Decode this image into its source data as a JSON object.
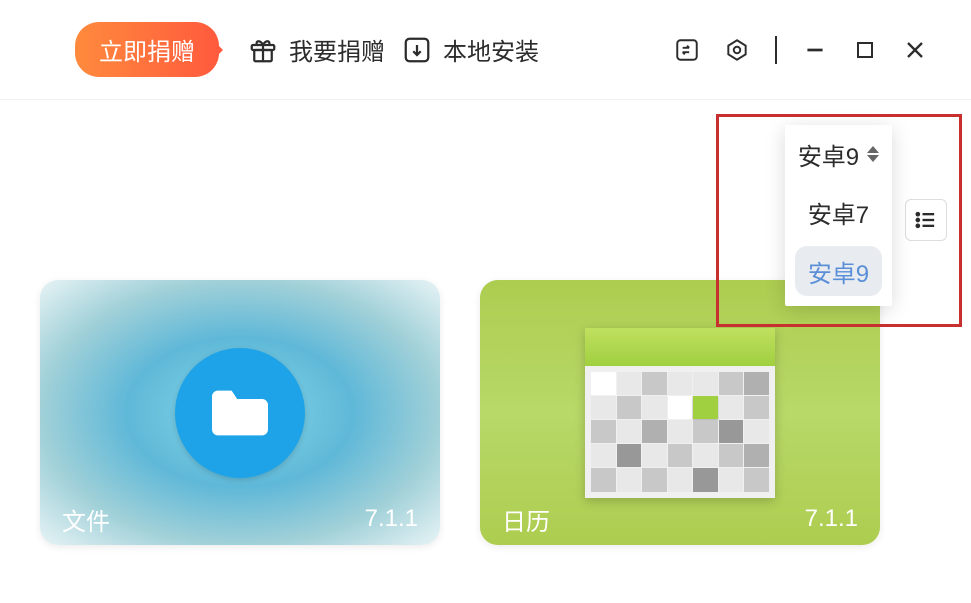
{
  "header": {
    "donate_btn_label": "立即捐赠",
    "want_donate_label": "我要捐赠",
    "local_install_label": "本地安装"
  },
  "dropdown": {
    "current": "安卓9",
    "options": [
      "安卓7",
      "安卓9"
    ],
    "selected_index": 1
  },
  "cards": {
    "files": {
      "name": "文件",
      "version": "7.1.1"
    },
    "calendar": {
      "name": "日历",
      "version": "7.1.1"
    }
  }
}
